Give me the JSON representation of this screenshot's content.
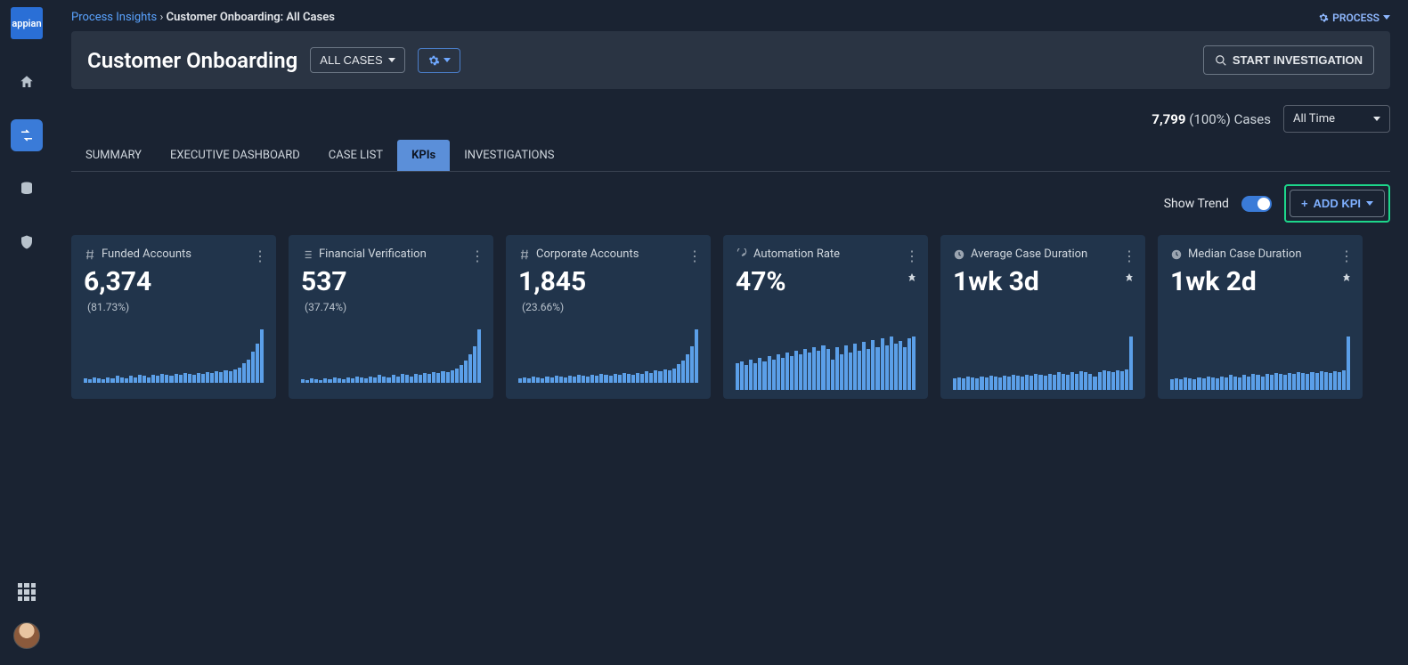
{
  "breadcrumb": {
    "root": "Process Insights",
    "current": "Customer Onboarding: All Cases"
  },
  "process_menu": "PROCESS",
  "header": {
    "title": "Customer Onboarding",
    "filter": "ALL CASES",
    "start_btn": "START INVESTIGATION"
  },
  "stats": {
    "count": "7,799",
    "pct": "(100%)",
    "label": "Cases",
    "time_filter": "All Time"
  },
  "tabs": [
    "SUMMARY",
    "EXECUTIVE DASHBOARD",
    "CASE LIST",
    "KPIs",
    "INVESTIGATIONS"
  ],
  "active_tab": 3,
  "controls": {
    "trend_label": "Show Trend",
    "add_kpi": "ADD KPI"
  },
  "kpis": [
    {
      "icon": "hash",
      "title": "Funded Accounts",
      "value": "6,374",
      "pct": "(81.73%)",
      "pin": false,
      "spark": [
        5,
        4,
        6,
        5,
        4,
        6,
        5,
        7,
        6,
        5,
        7,
        6,
        8,
        7,
        6,
        8,
        7,
        9,
        8,
        7,
        9,
        8,
        10,
        9,
        8,
        10,
        9,
        11,
        10,
        12,
        11,
        13,
        12,
        14,
        16,
        20,
        24,
        32,
        40,
        55
      ]
    },
    {
      "icon": "list",
      "title": "Financial Verification",
      "value": "537",
      "pct": "(37.74%)",
      "pin": false,
      "spark": [
        4,
        3,
        5,
        4,
        3,
        5,
        4,
        6,
        5,
        4,
        6,
        5,
        7,
        6,
        5,
        7,
        6,
        8,
        7,
        6,
        8,
        7,
        9,
        8,
        7,
        9,
        8,
        10,
        9,
        11,
        10,
        12,
        11,
        13,
        15,
        19,
        23,
        30,
        38,
        56
      ]
    },
    {
      "icon": "hash",
      "title": "Corporate Accounts",
      "value": "1,845",
      "pct": "(23.66%)",
      "pin": false,
      "spark": [
        4,
        5,
        4,
        6,
        5,
        4,
        6,
        5,
        7,
        6,
        5,
        7,
        6,
        8,
        7,
        6,
        8,
        7,
        9,
        8,
        7,
        9,
        8,
        10,
        9,
        8,
        10,
        9,
        11,
        10,
        12,
        11,
        13,
        12,
        14,
        18,
        22,
        28,
        36,
        52
      ]
    },
    {
      "icon": "gauge",
      "title": "Automation Rate",
      "value": "47%",
      "pct": "",
      "pin": true,
      "spark": [
        30,
        32,
        28,
        34,
        30,
        36,
        32,
        38,
        34,
        40,
        36,
        42,
        38,
        44,
        40,
        46,
        42,
        48,
        44,
        50,
        46,
        34,
        48,
        40,
        50,
        42,
        52,
        44,
        54,
        46,
        56,
        48,
        58,
        50,
        60,
        52,
        55,
        48,
        58,
        60
      ]
    },
    {
      "icon": "clock",
      "title": "Average Case Duration",
      "value": "1wk 3d",
      "pct": "",
      "pin": true,
      "spark": [
        12,
        13,
        12,
        14,
        13,
        12,
        14,
        13,
        15,
        14,
        13,
        15,
        14,
        16,
        15,
        14,
        16,
        15,
        17,
        16,
        15,
        17,
        16,
        18,
        17,
        16,
        18,
        17,
        19,
        18,
        17,
        14,
        18,
        20,
        19,
        18,
        20,
        19,
        21,
        55
      ]
    },
    {
      "icon": "clock",
      "title": "Median Case Duration",
      "value": "1wk 2d",
      "pct": "",
      "pin": true,
      "spark": [
        12,
        13,
        12,
        14,
        13,
        12,
        14,
        13,
        15,
        14,
        13,
        15,
        14,
        16,
        15,
        14,
        16,
        15,
        17,
        16,
        15,
        17,
        16,
        18,
        17,
        16,
        18,
        17,
        19,
        18,
        17,
        19,
        18,
        20,
        19,
        18,
        20,
        19,
        21,
        58
      ]
    }
  ]
}
